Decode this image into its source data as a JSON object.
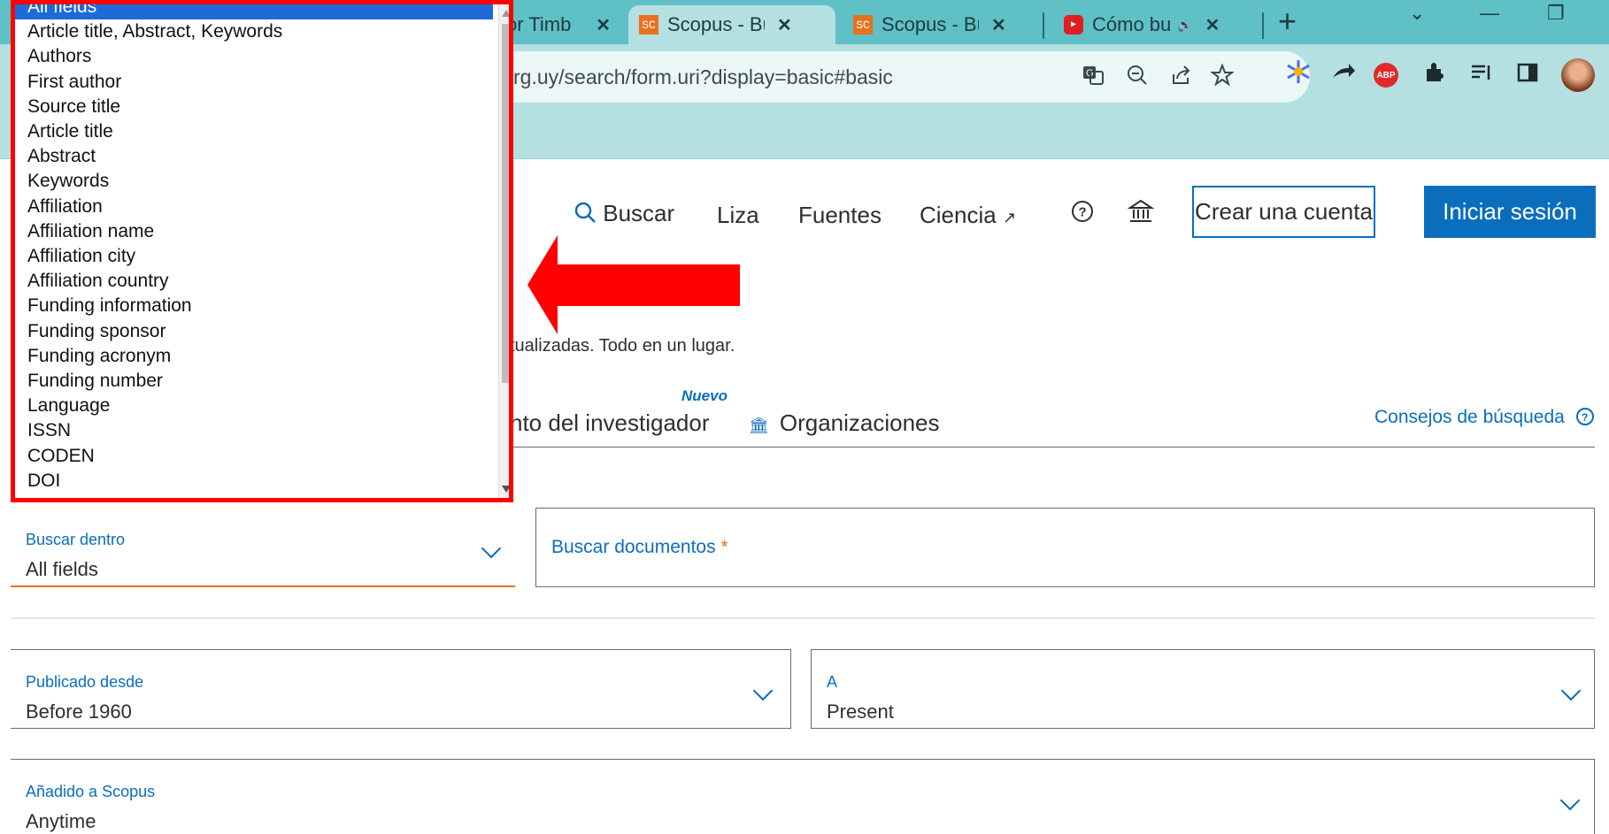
{
  "browser": {
    "tabs": [
      {
        "label": "or Timb",
        "close": "✕"
      },
      {
        "label": "Scopus - Búsq",
        "favicon": "SC",
        "close": "✕"
      },
      {
        "label": "Scopus - Búsq",
        "favicon": "SC",
        "close": "✕"
      },
      {
        "label": "Cómo bus",
        "favicon": "▶",
        "audio": "🔈",
        "close": "✕"
      }
    ],
    "new_tab": "+",
    "window_controls": {
      "list": "⌄",
      "minimize": "—",
      "restore": "❐"
    },
    "url": "rg.uy/search/form.uri?display=basic#basic",
    "omnibox_icons": [
      "translate-icon",
      "zoom-out-icon",
      "share-icon",
      "star-icon"
    ],
    "extensions": {
      "abp_label": "ABP"
    }
  },
  "nav": {
    "search_icon": "⚲",
    "search": "Buscar",
    "lists": "Liza",
    "sources": "Fuentes",
    "science": "Ciencia",
    "science_external_icon": "↗",
    "help_icon": "?",
    "institution_icon": "🏛",
    "create_account": "Crear una cuenta",
    "sign_in": "Iniciar sesión"
  },
  "hero": {
    "tagline": "tualizadas. Todo en un lugar."
  },
  "search_tabs": {
    "new_badge": "Nuevo",
    "researcher": "nto del investigador",
    "organizations": "Organizaciones",
    "organizations_icon": "🏛",
    "tips": "Consejos de búsqueda",
    "tips_icon": "?"
  },
  "form": {
    "search_within": {
      "label": "Buscar dentro",
      "value": "All fields"
    },
    "search_docs": {
      "label": "Buscar documentos",
      "required_mark": "*"
    },
    "published_from": {
      "label": "Publicado desde",
      "value": "Before 1960"
    },
    "to": {
      "label": "A",
      "value": "Present"
    },
    "added_to_scopus": {
      "label": "Añadido a Scopus",
      "value": "Anytime"
    }
  },
  "dropdown": {
    "selected_index": 0,
    "options": [
      "All fields",
      "Article title, Abstract, Keywords",
      "Authors",
      "First author",
      "Source title",
      "Article title",
      "Abstract",
      "Keywords",
      "Affiliation",
      "Affiliation name",
      "Affiliation city",
      "Affiliation country",
      "Funding information",
      "Funding sponsor",
      "Funding acronym",
      "Funding number",
      "Language",
      "ISSN",
      "CODEN",
      "DOI"
    ]
  },
  "colors": {
    "accent": "#0a6ebd",
    "orange": "#e9711c",
    "highlight": "#ff0000",
    "selection": "#1e6ad8",
    "chrome": "#5fc0c6"
  }
}
